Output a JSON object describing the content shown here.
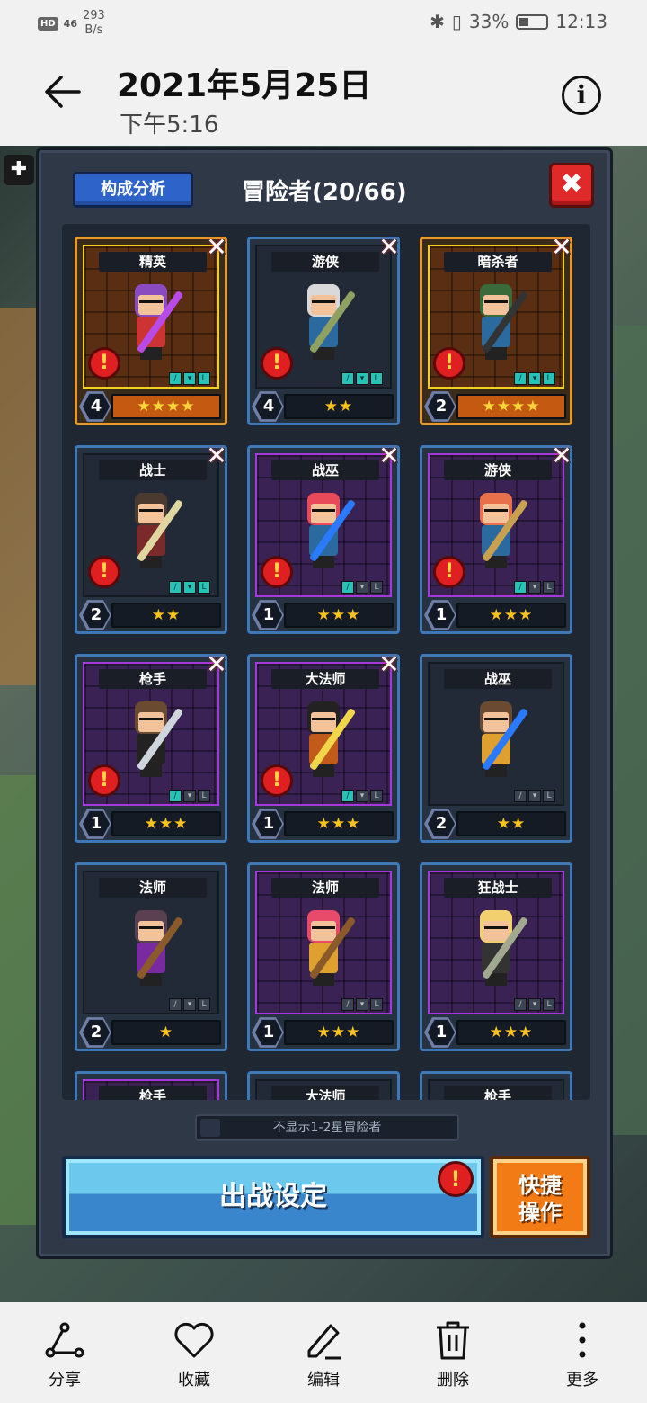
{
  "status": {
    "hd": "HD",
    "signal": "46",
    "speed_value": "293",
    "speed_unit": "B/s",
    "battery": "33%",
    "time": "12:13"
  },
  "header": {
    "title": "2021年5月25日",
    "subtitle": "下午5:16"
  },
  "panel": {
    "analysis_label": "构成分析",
    "title": "冒险者(20/66)",
    "close_label": "✖",
    "toggle_label": "不显示1-2星冒险者",
    "sortie_label": "出战设定",
    "quick_label_1": "快捷",
    "quick_label_2": "操作"
  },
  "cards": [
    {
      "cls": "精英",
      "level": "4",
      "stars": "★★★★",
      "style": "gold",
      "alert": true,
      "x": true,
      "hair": "#8a4ac0",
      "shirt": "#c33",
      "weapon": "#b84ae8"
    },
    {
      "cls": "游侠",
      "level": "4",
      "stars": "★★",
      "style": "plain",
      "alert": true,
      "x": true,
      "hair": "#d9d9d9",
      "shirt": "#2b6a9e",
      "weapon": "#8fa061"
    },
    {
      "cls": "暗杀者",
      "level": "2",
      "stars": "★★★★",
      "style": "gold",
      "alert": true,
      "x": true,
      "hair": "#3a6a3a",
      "shirt": "#2b6a9e",
      "weapon": "#333"
    },
    {
      "cls": "战士",
      "level": "2",
      "stars": "★★",
      "style": "plain",
      "alert": true,
      "x": true,
      "hair": "#4a3a30",
      "shirt": "#7a2a2a",
      "weapon": "#e0d6a0"
    },
    {
      "cls": "战巫",
      "level": "1",
      "stars": "★★★",
      "style": "purple",
      "alert": true,
      "x": true,
      "hair": "#e84a5a",
      "shirt": "#2b6a9e",
      "weapon": "#2a7aff"
    },
    {
      "cls": "游侠",
      "level": "1",
      "stars": "★★★",
      "style": "purple",
      "alert": true,
      "x": true,
      "hair": "#e8704a",
      "shirt": "#2b6a9e",
      "weapon": "#c8a050"
    },
    {
      "cls": "枪手",
      "level": "1",
      "stars": "★★★",
      "style": "purple",
      "alert": true,
      "x": true,
      "hair": "#6a4a30",
      "shirt": "#222",
      "weapon": "#cfd6de"
    },
    {
      "cls": "大法师",
      "level": "1",
      "stars": "★★★",
      "style": "purple",
      "alert": true,
      "x": true,
      "hair": "#222",
      "shirt": "#c25a1a",
      "weapon": "#f2d64a"
    },
    {
      "cls": "战巫",
      "level": "2",
      "stars": "★★",
      "style": "plain",
      "alert": false,
      "x": false,
      "hair": "#6a4a30",
      "shirt": "#e0a030",
      "weapon": "#2a7aff"
    },
    {
      "cls": "法师",
      "level": "2",
      "stars": "★",
      "style": "plain",
      "alert": false,
      "x": false,
      "hair": "#5a4050",
      "shirt": "#7a2aa0",
      "weapon": "#8a5a2a"
    },
    {
      "cls": "法师",
      "level": "1",
      "stars": "★★★",
      "style": "purple",
      "alert": false,
      "x": false,
      "hair": "#e84a6a",
      "shirt": "#e0a030",
      "weapon": "#8a5a2a"
    },
    {
      "cls": "狂战士",
      "level": "1",
      "stars": "★★★",
      "style": "purple",
      "alert": false,
      "x": false,
      "hair": "#f2d070",
      "shirt": "#333",
      "weapon": "#a0a890"
    },
    {
      "cls": "枪手",
      "level": "",
      "stars": "",
      "style": "purple",
      "alert": false,
      "x": false,
      "hair": "#6a4a30",
      "shirt": "#222",
      "weapon": "#cfd6de"
    },
    {
      "cls": "大法师",
      "level": "",
      "stars": "",
      "style": "plain",
      "alert": false,
      "x": false,
      "hair": "#222",
      "shirt": "#c25a1a",
      "weapon": "#f2d64a"
    },
    {
      "cls": "枪手",
      "level": "",
      "stars": "",
      "style": "plain",
      "alert": false,
      "x": false,
      "hair": "#6a4a30",
      "shirt": "#222",
      "weapon": "#cfd6de"
    }
  ],
  "bottom": {
    "share": "分享",
    "favorite": "收藏",
    "edit": "编辑",
    "delete": "删除",
    "more": "更多"
  }
}
